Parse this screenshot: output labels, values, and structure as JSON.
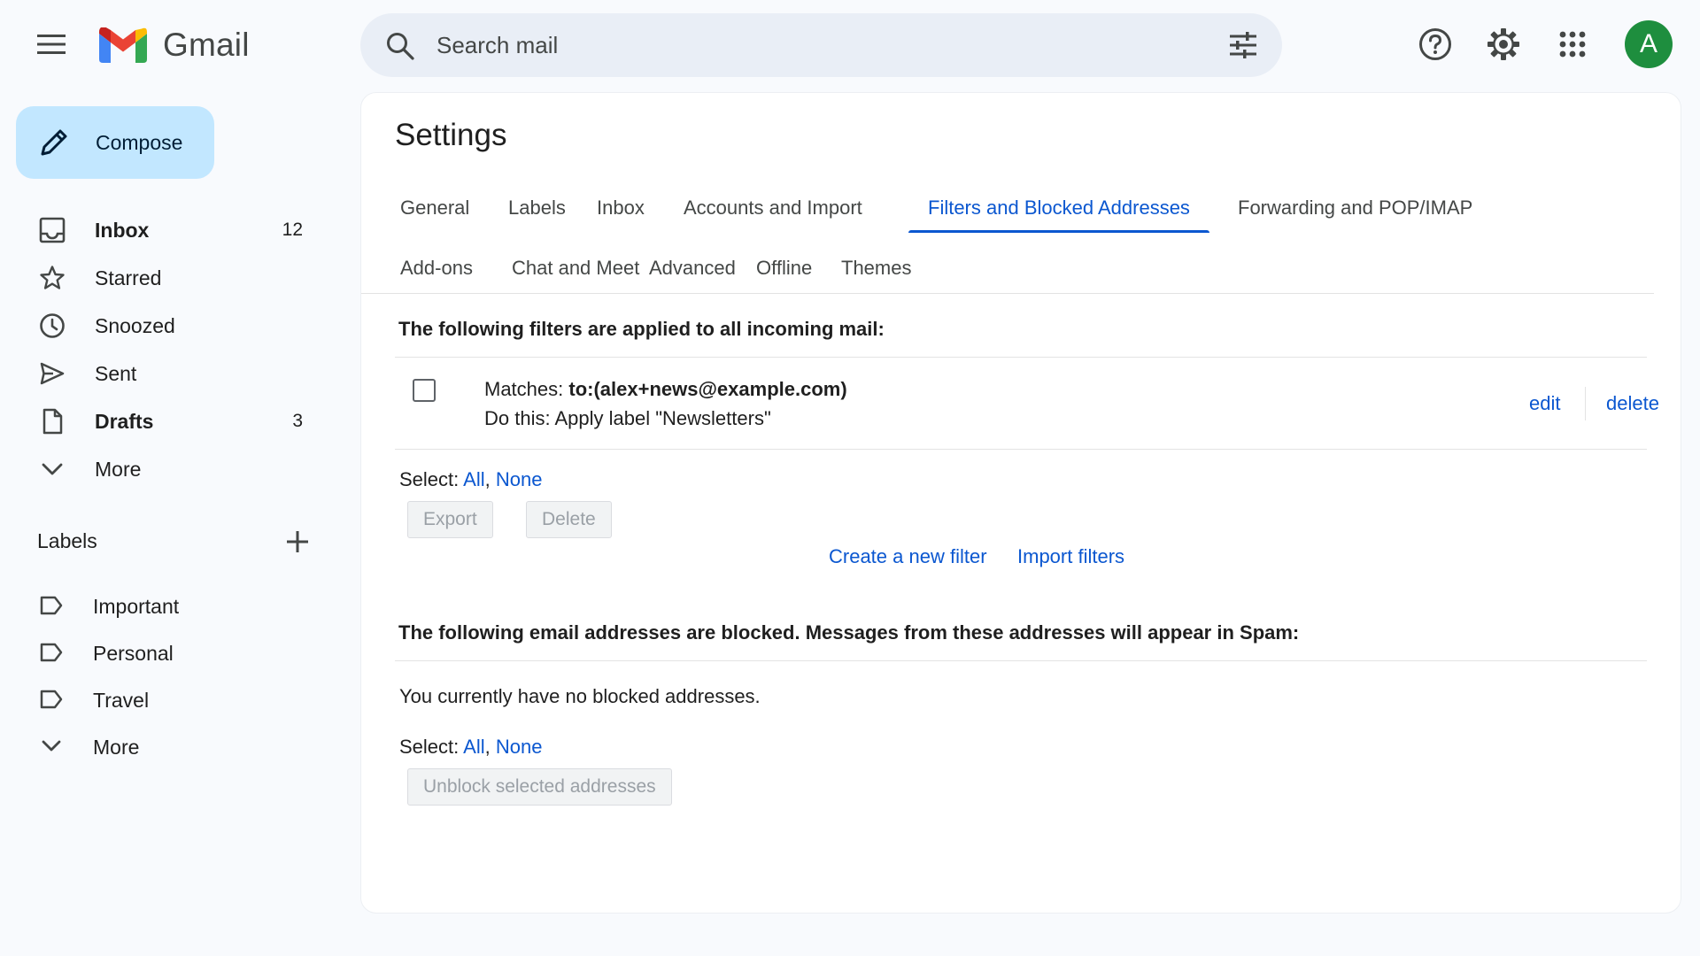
{
  "app": {
    "name": "Gmail",
    "brand_colors": {
      "blue": "#4285f4",
      "red": "#ea4335",
      "yellow": "#fbbc04",
      "green": "#34a853"
    }
  },
  "header": {
    "menu_icon": "hamburger-menu-icon",
    "search": {
      "placeholder": "Search mail",
      "value": ""
    },
    "icons": [
      "help-icon",
      "settings-gear-icon",
      "apps-grid-icon"
    ],
    "avatar": {
      "initial": "A",
      "color": "#1e8e3e"
    }
  },
  "sidebar": {
    "compose_label": "Compose",
    "items": [
      {
        "label": "Inbox",
        "count": "12",
        "bold": true,
        "icon": "inbox-icon"
      },
      {
        "label": "Starred",
        "count": "",
        "bold": false,
        "icon": "star-icon"
      },
      {
        "label": "Snoozed",
        "count": "",
        "bold": false,
        "icon": "clock-icon"
      },
      {
        "label": "Sent",
        "count": "",
        "bold": false,
        "icon": "send-icon"
      },
      {
        "label": "Drafts",
        "count": "3",
        "bold": true,
        "icon": "draft-icon"
      },
      {
        "label": "More",
        "count": "",
        "bold": false,
        "icon": "chevron-down-icon"
      }
    ],
    "labels_header": "Labels",
    "labels": [
      {
        "label": "Important",
        "icon": "label-icon"
      },
      {
        "label": "Personal",
        "icon": "label-icon"
      },
      {
        "label": "Travel",
        "icon": "label-icon"
      },
      {
        "label": "More",
        "icon": "chevron-down-icon"
      }
    ]
  },
  "settings": {
    "title": "Settings",
    "tabs_row1": [
      {
        "label": "General",
        "active": false
      },
      {
        "label": "Labels",
        "active": false
      },
      {
        "label": "Inbox",
        "active": false
      },
      {
        "label": "Accounts and Import",
        "active": false
      },
      {
        "label": "Filters and Blocked Addresses",
        "active": true
      },
      {
        "label": "Forwarding and POP/IMAP",
        "active": false
      }
    ],
    "tabs_row2": [
      {
        "label": "Add-ons",
        "active": false
      },
      {
        "label": "Chat and Meet",
        "active": false
      },
      {
        "label": "Advanced",
        "active": false
      },
      {
        "label": "Offline",
        "active": false
      },
      {
        "label": "Themes",
        "active": false
      }
    ],
    "filters": {
      "heading": "The following filters are applied to all incoming mail:",
      "rows": [
        {
          "matches_prefix": "Matches: ",
          "matches_value": "to:(alex+news@example.com)",
          "action": "Do this: Apply label \"Newsletters\"",
          "edit_label": "edit",
          "delete_label": "delete"
        }
      ],
      "select_prefix": "Select: ",
      "select_all": "All",
      "select_sep": ", ",
      "select_none": "None",
      "export_label": "Export",
      "delete_label": "Delete",
      "create_filter_label": "Create a new filter",
      "import_filters_label": "Import filters"
    },
    "blocked": {
      "heading": "The following email addresses are blocked. Messages from these addresses will appear in Spam:",
      "empty_message": "You currently have no blocked addresses.",
      "select_prefix": "Select: ",
      "select_all": "All",
      "select_sep": ", ",
      "select_none": "None",
      "unblock_label": "Unblock selected addresses"
    }
  }
}
